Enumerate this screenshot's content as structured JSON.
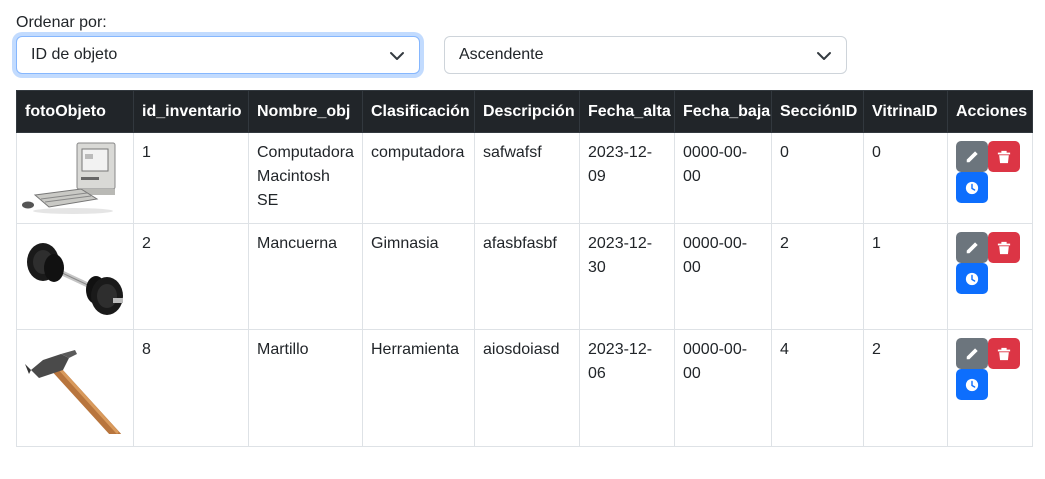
{
  "sort": {
    "label": "Ordenar por:",
    "field_value": "ID de objeto",
    "order_value": "Ascendente"
  },
  "table": {
    "headers": [
      "fotoObjeto",
      "id_inventario",
      "Nombre_obj",
      "Clasificación",
      "Descripción",
      "Fecha_alta",
      "Fecha_baja",
      "SecciónID",
      "VitrinaID",
      "Acciones"
    ],
    "rows": [
      {
        "image": "macintosh-computer-image",
        "id": "1",
        "nombre": "Computadora Macintosh SE",
        "clasificacion": "computadora",
        "descripcion": "safwafsf",
        "fecha_alta": "2023-12-09",
        "fecha_baja": "0000-00-00",
        "seccion": "0",
        "vitrina": "0"
      },
      {
        "image": "dumbbell-image",
        "id": "2",
        "nombre": "Mancuerna",
        "clasificacion": "Gimnasia",
        "descripcion": "afasbfasbf",
        "fecha_alta": "2023-12-30",
        "fecha_baja": "0000-00-00",
        "seccion": "2",
        "vitrina": "1"
      },
      {
        "image": "hammer-image",
        "id": "8",
        "nombre": "Martillo",
        "clasificacion": "Herramienta",
        "descripcion": "aiosdoiasd",
        "fecha_alta": "2023-12-06",
        "fecha_baja": "0000-00-00",
        "seccion": "4",
        "vitrina": "2"
      }
    ]
  },
  "actions": {
    "icons": [
      "pencil-icon",
      "trash-icon",
      "clock-icon"
    ],
    "colors": {
      "edit": "#6c757d",
      "delete": "#dc3545",
      "history": "#0d6efd"
    }
  }
}
